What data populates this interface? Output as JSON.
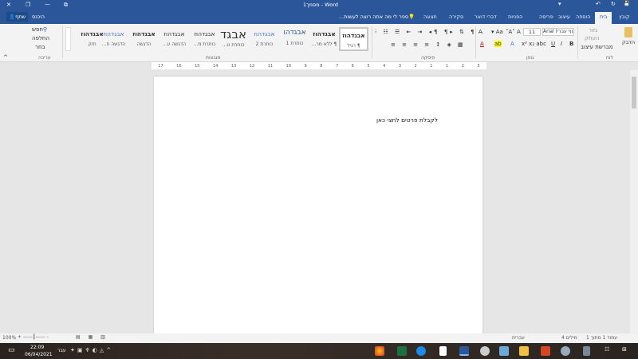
{
  "window": {
    "title": "מסמך1 - Word",
    "close": "✕",
    "restore": "❐",
    "minimize": "—",
    "ribbon_display": "⧉"
  },
  "qat": {
    "save": "💾",
    "undo": "↶",
    "redo": "↻",
    "customize": "▾"
  },
  "tabs": [
    "קובץ",
    "בית",
    "הוספה",
    "עיצוב",
    "פריסה",
    "הפניות",
    "דברי דואר",
    "סקירה",
    "תצוגה"
  ],
  "tell_me": "ספר לי מה אתה רוצה לעשות...",
  "account": {
    "signin": "היכנס",
    "share": "שתף"
  },
  "clipboard": {
    "paste": "הדבק",
    "cut": "גזור",
    "copy": "העתק",
    "format_painter": "מברשת עיצוב",
    "label": "לוח"
  },
  "font": {
    "name": "Arial (גוף עברי)",
    "size": "11",
    "label": "גופן",
    "bold": "B",
    "italic": "I",
    "underline": "U"
  },
  "paragraph": {
    "label": "פיסקה"
  },
  "styles": {
    "label": "סגנונות",
    "items": [
      {
        "sample": "אבגדהוז",
        "name": "¶ רגיל"
      },
      {
        "sample": "אבגדהוז",
        "name": "¶ ללא מר..."
      },
      {
        "sample": "אבגדהו",
        "name": "כותרת 1"
      },
      {
        "sample": "אבגדהוז",
        "name": "כותרת 2"
      },
      {
        "sample": "אבגד",
        "name": "כותרת ט..."
      },
      {
        "sample": "אבגדהוז",
        "name": "כותרת מ..."
      },
      {
        "sample": "אבגדהוז",
        "name": "הדגשה ע..."
      },
      {
        "sample": "אבגדהוז",
        "name": "הדגשה"
      },
      {
        "sample": "אבגדהוז",
        "name": "הדגשה ח..."
      },
      {
        "sample": "אבגדהוז",
        "name": "חזק"
      }
    ]
  },
  "editing": {
    "label": "עריכה",
    "find": "חפש",
    "replace": "החלפה",
    "select": "בחר"
  },
  "ruler": [
    "3",
    "2",
    "1",
    "1",
    "2",
    "3",
    "4",
    "5",
    "6",
    "7",
    "8",
    "9",
    "10",
    "11",
    "12",
    "13",
    "14",
    "15",
    "16",
    "17"
  ],
  "document": {
    "text": "לקבלת פרטים לחצי כאן"
  },
  "status": {
    "page": "עמוד 1 מתוך 1",
    "words": "4 מילים",
    "language": "עברית",
    "zoom": "100%"
  },
  "taskbar": {
    "time": "22:09",
    "date": "06/04/2021",
    "lang": "עבר"
  }
}
